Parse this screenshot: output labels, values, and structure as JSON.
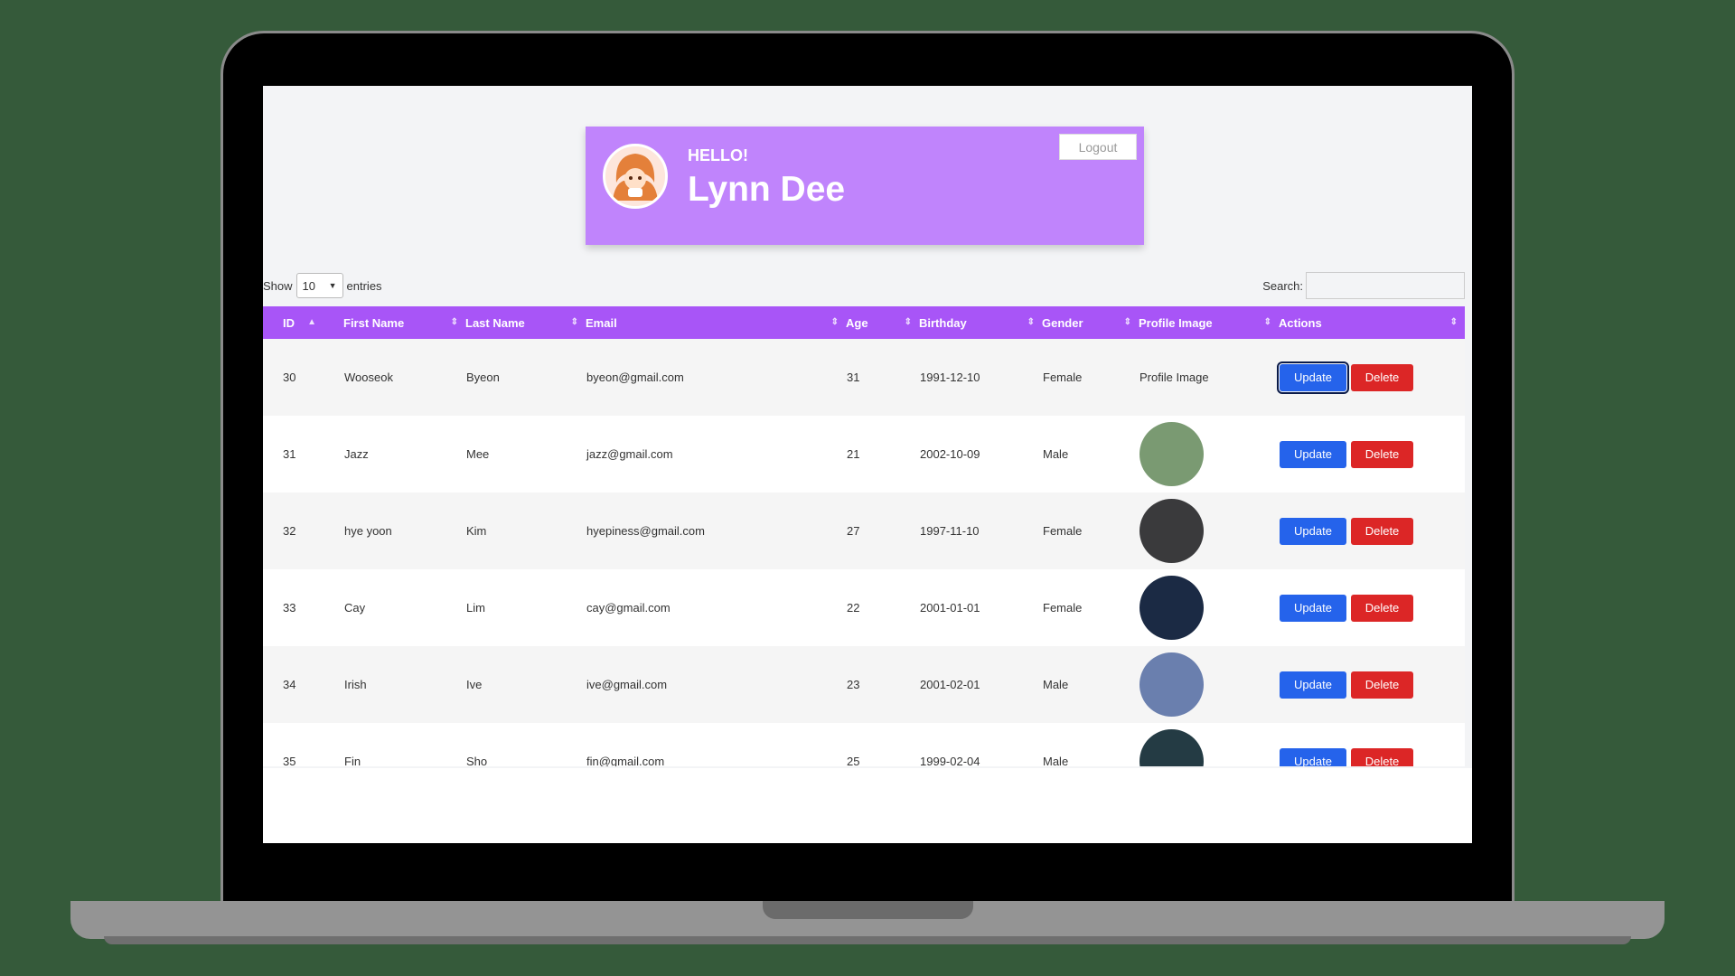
{
  "header": {
    "greeting": "HELLO!",
    "username": "Lynn Dee",
    "logout_label": "Logout"
  },
  "table_controls": {
    "show_label": "Show",
    "entries_value": "10",
    "entries_label": "entries",
    "search_label": "Search:",
    "search_value": ""
  },
  "table": {
    "columns": [
      "ID",
      "First Name",
      "Last Name",
      "Email",
      "Age",
      "Birthday",
      "Gender",
      "Profile Image",
      "Actions"
    ],
    "update_label": "Update",
    "delete_label": "Delete",
    "rows": [
      {
        "id": "30",
        "first": "Wooseok",
        "last": "Byeon",
        "email": "byeon@gmail.com",
        "age": "31",
        "birthday": "1991-12-10",
        "gender": "Female",
        "image": "broken",
        "image_alt": "Profile Image",
        "avatar_color": "",
        "update_focused": true
      },
      {
        "id": "31",
        "first": "Jazz",
        "last": "Mee",
        "email": "jazz@gmail.com",
        "age": "21",
        "birthday": "2002-10-09",
        "gender": "Male",
        "image": "green-landscape-avatar",
        "avatar_color": "#7a9a72",
        "update_focused": false
      },
      {
        "id": "32",
        "first": "hye yoon",
        "last": "Kim",
        "email": "hyepiness@gmail.com",
        "age": "27",
        "birthday": "1997-11-10",
        "gender": "Female",
        "image": "dark-cat-avatar",
        "avatar_color": "#3a3a3c",
        "update_focused": false
      },
      {
        "id": "33",
        "first": "Cay",
        "last": "Lim",
        "email": "cay@gmail.com",
        "age": "22",
        "birthday": "2001-01-01",
        "gender": "Female",
        "image": "night-city-avatar",
        "avatar_color": "#1b2a44",
        "update_focused": false
      },
      {
        "id": "34",
        "first": "Irish",
        "last": "Ive",
        "email": "ive@gmail.com",
        "age": "23",
        "birthday": "2001-02-01",
        "gender": "Male",
        "image": "totoro-avatar",
        "avatar_color": "#6a7fae",
        "update_focused": false
      },
      {
        "id": "35",
        "first": "Fin",
        "last": "Sho",
        "email": "fin@gmail.com",
        "age": "25",
        "birthday": "1999-02-04",
        "gender": "Male",
        "image": "dark-scene-avatar",
        "avatar_color": "#243b44",
        "update_focused": false
      }
    ]
  },
  "colors": {
    "background": "#355a3a",
    "card": "#c084fc",
    "table_header": "#a855f7",
    "update": "#2563eb",
    "delete": "#dc2626"
  }
}
